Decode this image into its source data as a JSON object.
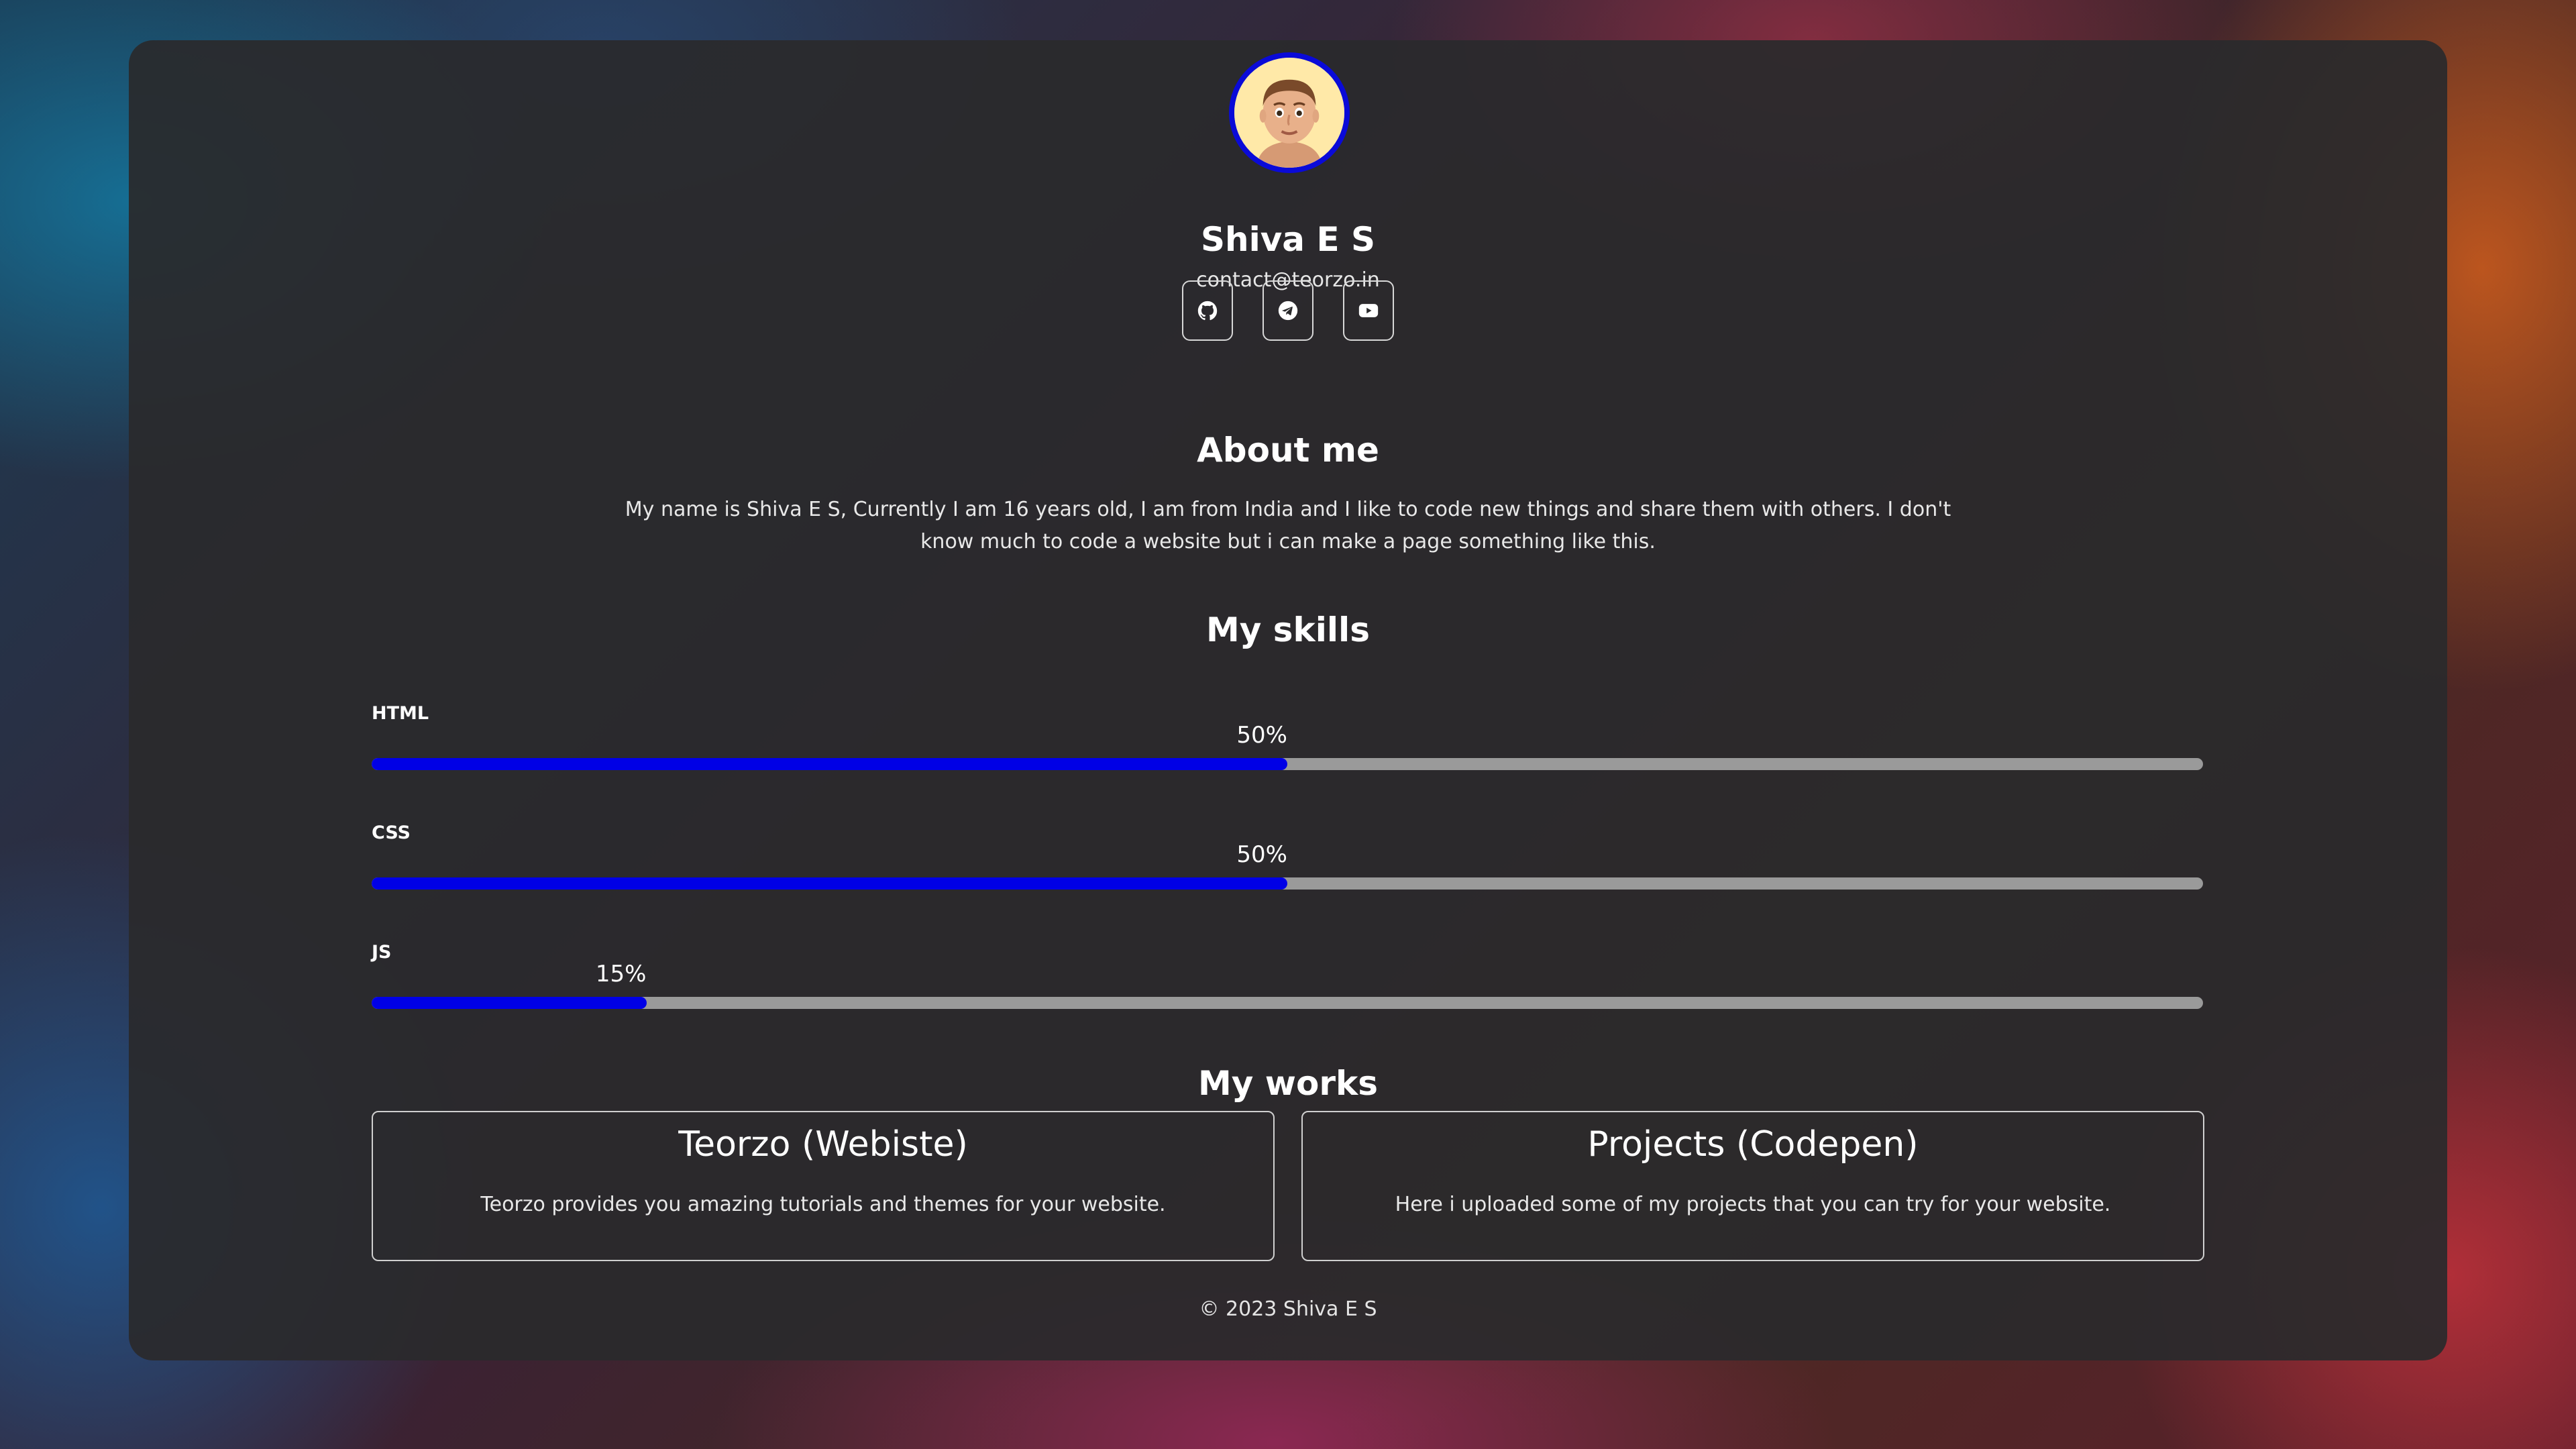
{
  "profile": {
    "name": "Shiva E S",
    "email": "contact@teorzo.in"
  },
  "socials": [
    {
      "name": "GitHub",
      "icon": "github-icon"
    },
    {
      "name": "Telegram",
      "icon": "telegram-icon"
    },
    {
      "name": "YouTube",
      "icon": "youtube-icon"
    }
  ],
  "about": {
    "title": "About me",
    "text": "My name is Shiva E S, Currently I am 16 years old, I am from India and I like to code new things and share them with others. I don't know much to code a website but i can make a page something like this."
  },
  "skills": {
    "title": "My skills",
    "items": [
      {
        "label": "HTML",
        "percent_text": "50%",
        "level": 0.5
      },
      {
        "label": "CSS",
        "percent_text": "50%",
        "level": 0.5
      },
      {
        "label": "JS",
        "percent_text": "15%",
        "level": 0.15
      }
    ]
  },
  "works": {
    "title": "My works",
    "items": [
      {
        "title": "Teorzo (Webiste)",
        "desc": "Teorzo provides you amazing tutorials and themes for your website."
      },
      {
        "title": "Projects (Codepen)",
        "desc": "Here i uploaded some of my projects that you can try for your website."
      }
    ]
  },
  "footer": {
    "text": "© 2023 Shiva E S"
  },
  "colors": {
    "accent": "#0000e6",
    "track": "#9a9a9a",
    "card": "#2a2a2c"
  }
}
